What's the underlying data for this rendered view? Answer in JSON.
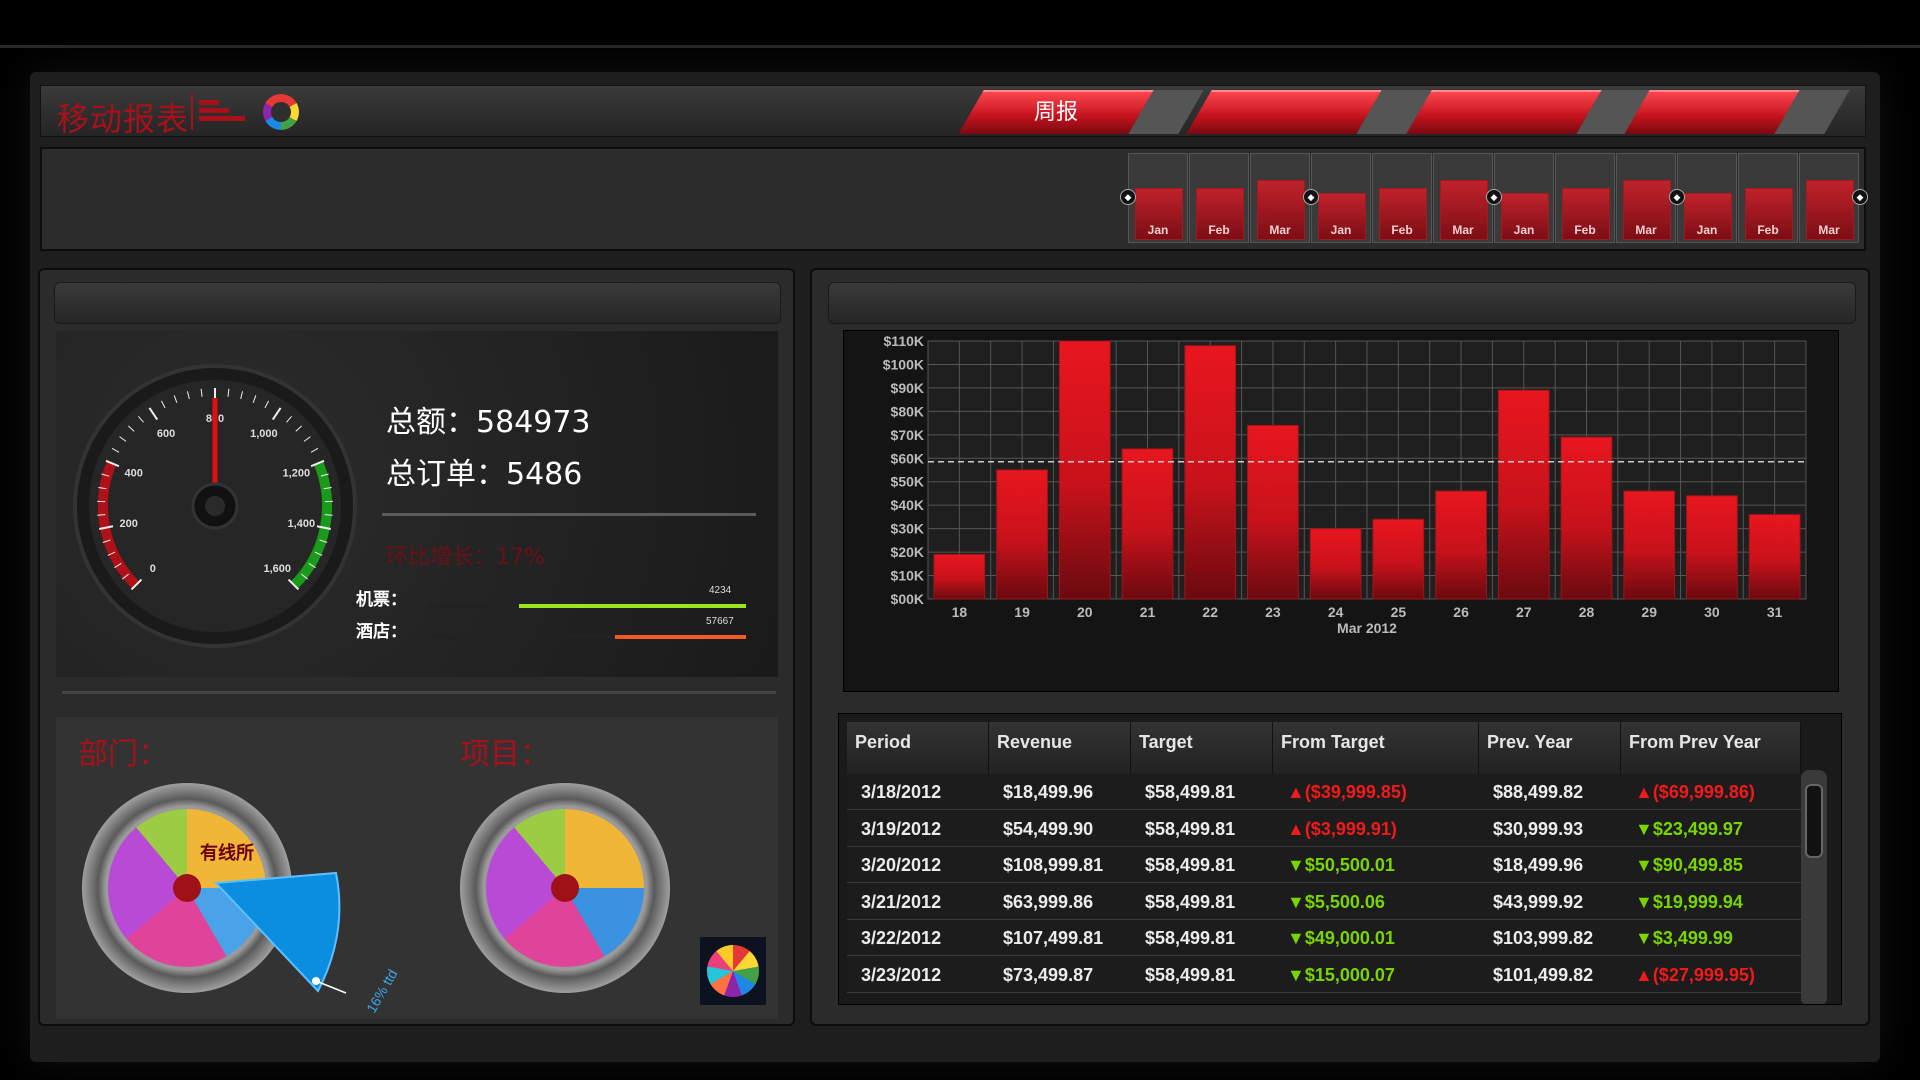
{
  "header": {
    "app_title": "移动报表",
    "tabs": [
      {
        "label": "周报"
      },
      {
        "label": ""
      },
      {
        "label": ""
      },
      {
        "label": ""
      }
    ],
    "icons": [
      "bar-logo-icon",
      "color-ring-icon"
    ]
  },
  "timeline": {
    "months": [
      "Jan",
      "Feb",
      "Mar",
      "Jan",
      "Feb",
      "Mar",
      "Jan",
      "Feb",
      "Mar",
      "Jan",
      "Feb",
      "Mar"
    ],
    "bar_fractions": [
      0.6,
      0.6,
      0.7,
      0.55,
      0.6,
      0.7,
      0.55,
      0.6,
      0.7,
      0.55,
      0.6,
      0.7
    ]
  },
  "summary": {
    "total_label": "总额：584973",
    "orders_label": "总订单：5486",
    "growth_label": "环比增长：17%",
    "flight_label": "机票：",
    "flight_value": "4234",
    "flight_fraction": 0.71,
    "hotel_label": "酒店：",
    "hotel_value": "57667",
    "hotel_fraction": 0.41
  },
  "speedometer": {
    "ticks": [
      "0",
      "200",
      "400",
      "600",
      "800",
      "1,000",
      "1,200",
      "1,400",
      "1,600"
    ],
    "value": 800,
    "min": 0,
    "max": 1600
  },
  "dept": {
    "dept_title": "部门：",
    "project_title": "项目：",
    "dept_slice_label": "有线所",
    "popout_label": "16% ttd"
  },
  "colors": {
    "accent": "#a8111a",
    "bar": "#e0161f",
    "positive": "#7ad400",
    "negative": "#f01a1a"
  },
  "chart_data": {
    "type": "bar",
    "categories": [
      "18",
      "19",
      "20",
      "21",
      "22",
      "23",
      "24",
      "25",
      "26",
      "27",
      "28",
      "29",
      "30",
      "31"
    ],
    "values": [
      19000,
      55000,
      110000,
      64000,
      108000,
      74000,
      30000,
      34000,
      46000,
      89000,
      69000,
      46000,
      44000,
      36000
    ],
    "target": 58499.81,
    "xlabel": "Mar 2012",
    "ylabel": "",
    "ylim": [
      0,
      110000
    ],
    "yticks": [
      "$00K",
      "$10K",
      "$20K",
      "$30K",
      "$40K",
      "$50K",
      "$60K",
      "$70K",
      "$80K",
      "$90K",
      "$100K",
      "$110K"
    ],
    "grid": true
  },
  "table": {
    "headers": [
      "Period",
      "Revenue",
      "Target",
      "From Target",
      "Prev. Year",
      "From Prev Year"
    ],
    "rows": [
      {
        "period": "3/18/2012",
        "revenue": "$18,499.96",
        "target": "$58,499.81",
        "from_target": "($39,999.85)",
        "ft_dir": "up",
        "ft_cls": "neg",
        "prev_year": "$88,499.82",
        "from_prev": "($69,999.86)",
        "fp_dir": "up",
        "fp_cls": "neg"
      },
      {
        "period": "3/19/2012",
        "revenue": "$54,499.90",
        "target": "$58,499.81",
        "from_target": "($3,999.91)",
        "ft_dir": "up",
        "ft_cls": "neg",
        "prev_year": "$30,999.93",
        "from_prev": "$23,499.97",
        "fp_dir": "down",
        "fp_cls": "pos"
      },
      {
        "period": "3/20/2012",
        "revenue": "$108,999.81",
        "target": "$58,499.81",
        "from_target": "$50,500.01",
        "ft_dir": "down",
        "ft_cls": "pos",
        "prev_year": "$18,499.96",
        "from_prev": "$90,499.85",
        "fp_dir": "down",
        "fp_cls": "pos"
      },
      {
        "period": "3/21/2012",
        "revenue": "$63,999.86",
        "target": "$58,499.81",
        "from_target": "$5,500.06",
        "ft_dir": "down",
        "ft_cls": "pos",
        "prev_year": "$43,999.92",
        "from_prev": "$19,999.94",
        "fp_dir": "down",
        "fp_cls": "pos"
      },
      {
        "period": "3/22/2012",
        "revenue": "$107,499.81",
        "target": "$58,499.81",
        "from_target": "$49,000.01",
        "ft_dir": "down",
        "ft_cls": "pos",
        "prev_year": "$103,999.82",
        "from_prev": "$3,499.99",
        "fp_dir": "down",
        "fp_cls": "pos"
      },
      {
        "period": "3/23/2012",
        "revenue": "$73,499.87",
        "target": "$58,499.81",
        "from_target": "$15,000.07",
        "ft_dir": "down",
        "ft_cls": "pos",
        "prev_year": "$101,499.82",
        "from_prev": "($27,999.95)",
        "fp_dir": "up",
        "fp_cls": "neg"
      }
    ]
  }
}
